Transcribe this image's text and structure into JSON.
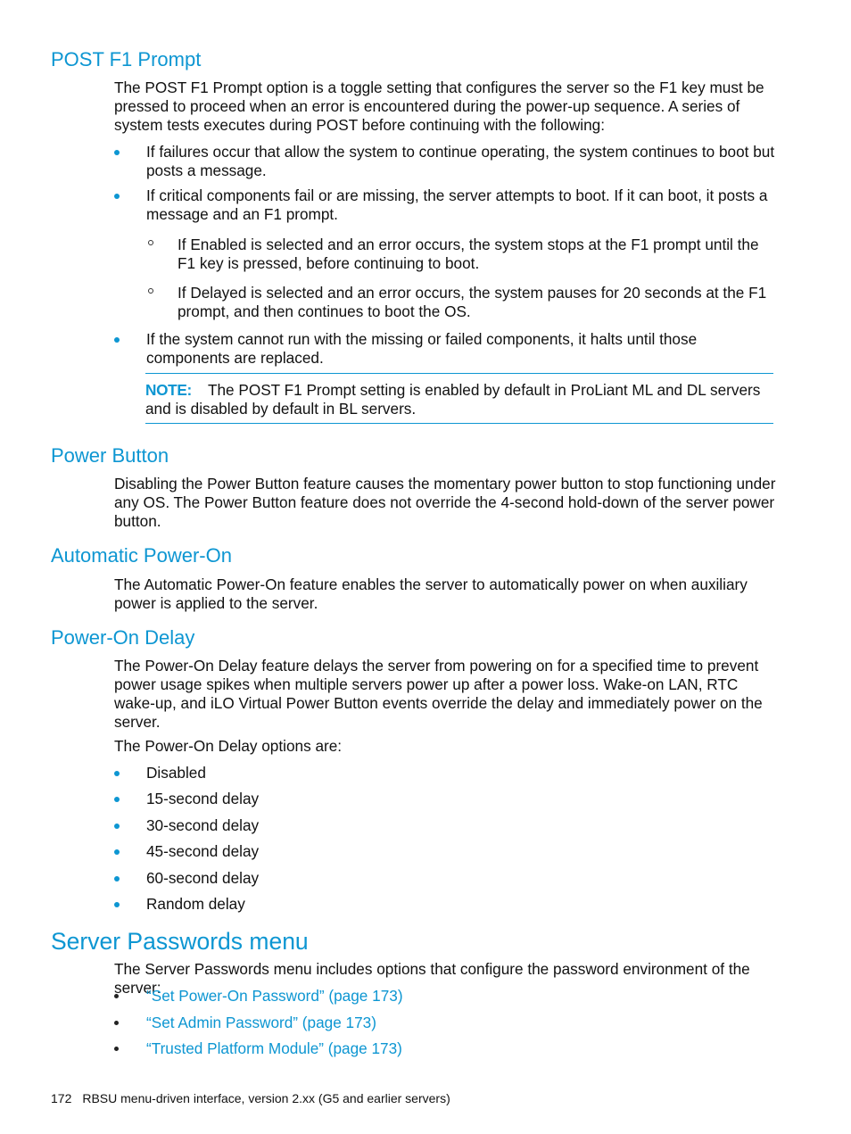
{
  "sections": {
    "post_f1": {
      "heading": "POST F1 Prompt",
      "intro": "The POST F1 Prompt option is a toggle setting that configures the server so the F1 key must be pressed to proceed when an error is encountered during the power-up sequence. A series of system tests executes during POST before continuing with the following:",
      "bullets": [
        "If failures occur that allow the system to continue operating, the system continues to boot but posts a message.",
        "If critical components fail or are missing, the server attempts to boot. If it can boot, it posts a message and an F1 prompt.",
        "If the system cannot run with the missing or failed components, it halts until those components are replaced."
      ],
      "sub_bullets": [
        "If Enabled is selected and an error occurs, the system stops at the F1 prompt until the F1 key is pressed, before continuing to boot.",
        "If Delayed is selected and an error occurs, the system pauses for 20 seconds at the F1 prompt, and then continues to boot the OS."
      ],
      "note_label": "NOTE:",
      "note_text": "The POST F1 Prompt setting is enabled by default in ProLiant ML and DL servers and is disabled by default in BL servers."
    },
    "power_button": {
      "heading": "Power Button",
      "text": "Disabling the Power Button feature causes the momentary power button to stop functioning under any OS. The Power Button feature does not override the 4-second hold-down of the server power button."
    },
    "auto_power_on": {
      "heading": "Automatic Power-On",
      "text": "The Automatic Power-On feature enables the server to automatically power on when auxiliary power is applied to the server."
    },
    "power_on_delay": {
      "heading": "Power-On Delay",
      "text": "The Power-On Delay feature delays the server from powering on for a specified time to prevent power usage spikes when multiple servers power up after a power loss. Wake-on LAN, RTC wake-up, and iLO Virtual Power Button events override the delay and immediately power on the server.",
      "options_intro": "The Power-On Delay options are:",
      "options": [
        "Disabled",
        "15-second delay",
        "30-second delay",
        "45-second delay",
        "60-second delay",
        "Random delay"
      ]
    },
    "server_passwords": {
      "heading": "Server Passwords menu",
      "text": "The Server Passwords menu includes options that configure the password environment of the server:",
      "links": [
        "“Set Power-On Password” (page 173)",
        "“Set Admin Password” (page 173)",
        "“Trusted Platform Module” (page 173)"
      ]
    }
  },
  "footer": {
    "page_number": "172",
    "title": "RBSU menu-driven interface, version 2.xx (G5 and earlier servers)"
  },
  "colors": {
    "accent": "#0d96d2",
    "text": "#111111"
  }
}
